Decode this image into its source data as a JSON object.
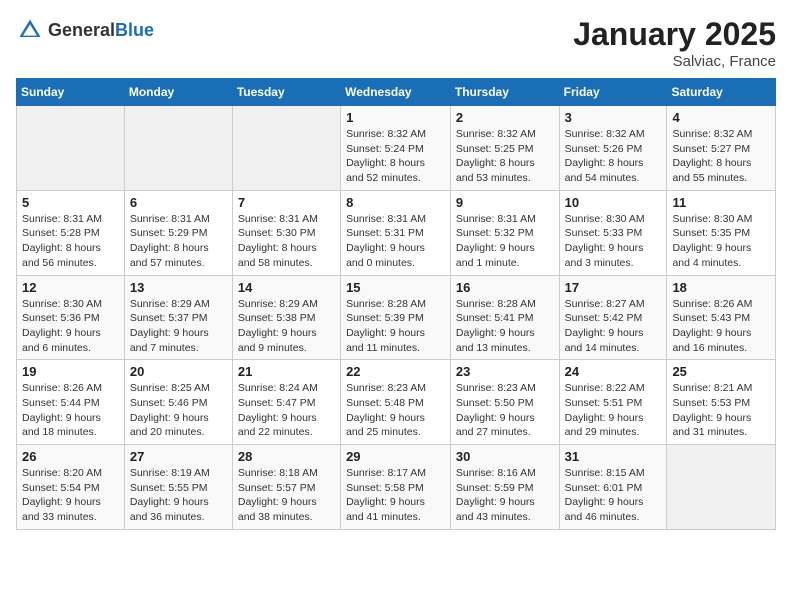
{
  "header": {
    "logo_general": "General",
    "logo_blue": "Blue",
    "month": "January 2025",
    "location": "Salviac, France"
  },
  "weekdays": [
    "Sunday",
    "Monday",
    "Tuesday",
    "Wednesday",
    "Thursday",
    "Friday",
    "Saturday"
  ],
  "weeks": [
    [
      {
        "day": "",
        "info": ""
      },
      {
        "day": "",
        "info": ""
      },
      {
        "day": "",
        "info": ""
      },
      {
        "day": "1",
        "info": "Sunrise: 8:32 AM\nSunset: 5:24 PM\nDaylight: 8 hours and 52 minutes."
      },
      {
        "day": "2",
        "info": "Sunrise: 8:32 AM\nSunset: 5:25 PM\nDaylight: 8 hours and 53 minutes."
      },
      {
        "day": "3",
        "info": "Sunrise: 8:32 AM\nSunset: 5:26 PM\nDaylight: 8 hours and 54 minutes."
      },
      {
        "day": "4",
        "info": "Sunrise: 8:32 AM\nSunset: 5:27 PM\nDaylight: 8 hours and 55 minutes."
      }
    ],
    [
      {
        "day": "5",
        "info": "Sunrise: 8:31 AM\nSunset: 5:28 PM\nDaylight: 8 hours and 56 minutes."
      },
      {
        "day": "6",
        "info": "Sunrise: 8:31 AM\nSunset: 5:29 PM\nDaylight: 8 hours and 57 minutes."
      },
      {
        "day": "7",
        "info": "Sunrise: 8:31 AM\nSunset: 5:30 PM\nDaylight: 8 hours and 58 minutes."
      },
      {
        "day": "8",
        "info": "Sunrise: 8:31 AM\nSunset: 5:31 PM\nDaylight: 9 hours and 0 minutes."
      },
      {
        "day": "9",
        "info": "Sunrise: 8:31 AM\nSunset: 5:32 PM\nDaylight: 9 hours and 1 minute."
      },
      {
        "day": "10",
        "info": "Sunrise: 8:30 AM\nSunset: 5:33 PM\nDaylight: 9 hours and 3 minutes."
      },
      {
        "day": "11",
        "info": "Sunrise: 8:30 AM\nSunset: 5:35 PM\nDaylight: 9 hours and 4 minutes."
      }
    ],
    [
      {
        "day": "12",
        "info": "Sunrise: 8:30 AM\nSunset: 5:36 PM\nDaylight: 9 hours and 6 minutes."
      },
      {
        "day": "13",
        "info": "Sunrise: 8:29 AM\nSunset: 5:37 PM\nDaylight: 9 hours and 7 minutes."
      },
      {
        "day": "14",
        "info": "Sunrise: 8:29 AM\nSunset: 5:38 PM\nDaylight: 9 hours and 9 minutes."
      },
      {
        "day": "15",
        "info": "Sunrise: 8:28 AM\nSunset: 5:39 PM\nDaylight: 9 hours and 11 minutes."
      },
      {
        "day": "16",
        "info": "Sunrise: 8:28 AM\nSunset: 5:41 PM\nDaylight: 9 hours and 13 minutes."
      },
      {
        "day": "17",
        "info": "Sunrise: 8:27 AM\nSunset: 5:42 PM\nDaylight: 9 hours and 14 minutes."
      },
      {
        "day": "18",
        "info": "Sunrise: 8:26 AM\nSunset: 5:43 PM\nDaylight: 9 hours and 16 minutes."
      }
    ],
    [
      {
        "day": "19",
        "info": "Sunrise: 8:26 AM\nSunset: 5:44 PM\nDaylight: 9 hours and 18 minutes."
      },
      {
        "day": "20",
        "info": "Sunrise: 8:25 AM\nSunset: 5:46 PM\nDaylight: 9 hours and 20 minutes."
      },
      {
        "day": "21",
        "info": "Sunrise: 8:24 AM\nSunset: 5:47 PM\nDaylight: 9 hours and 22 minutes."
      },
      {
        "day": "22",
        "info": "Sunrise: 8:23 AM\nSunset: 5:48 PM\nDaylight: 9 hours and 25 minutes."
      },
      {
        "day": "23",
        "info": "Sunrise: 8:23 AM\nSunset: 5:50 PM\nDaylight: 9 hours and 27 minutes."
      },
      {
        "day": "24",
        "info": "Sunrise: 8:22 AM\nSunset: 5:51 PM\nDaylight: 9 hours and 29 minutes."
      },
      {
        "day": "25",
        "info": "Sunrise: 8:21 AM\nSunset: 5:53 PM\nDaylight: 9 hours and 31 minutes."
      }
    ],
    [
      {
        "day": "26",
        "info": "Sunrise: 8:20 AM\nSunset: 5:54 PM\nDaylight: 9 hours and 33 minutes."
      },
      {
        "day": "27",
        "info": "Sunrise: 8:19 AM\nSunset: 5:55 PM\nDaylight: 9 hours and 36 minutes."
      },
      {
        "day": "28",
        "info": "Sunrise: 8:18 AM\nSunset: 5:57 PM\nDaylight: 9 hours and 38 minutes."
      },
      {
        "day": "29",
        "info": "Sunrise: 8:17 AM\nSunset: 5:58 PM\nDaylight: 9 hours and 41 minutes."
      },
      {
        "day": "30",
        "info": "Sunrise: 8:16 AM\nSunset: 5:59 PM\nDaylight: 9 hours and 43 minutes."
      },
      {
        "day": "31",
        "info": "Sunrise: 8:15 AM\nSunset: 6:01 PM\nDaylight: 9 hours and 46 minutes."
      },
      {
        "day": "",
        "info": ""
      }
    ]
  ]
}
